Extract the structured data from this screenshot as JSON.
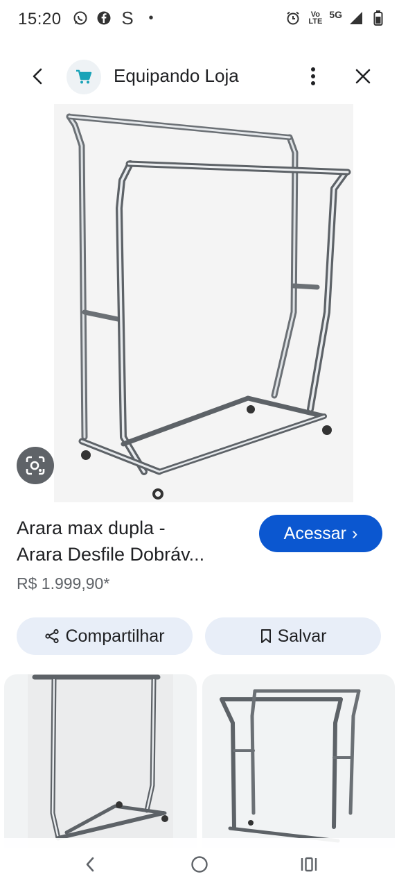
{
  "status_bar": {
    "time": "15:20",
    "left_icons": [
      "whatsapp-icon",
      "facebook-icon",
      "s-app-icon",
      "dot-icon"
    ],
    "s_glyph": "S",
    "dot_glyph": "•",
    "volte_line1": "Vo",
    "volte_line2": "LTE",
    "network": "5G",
    "right_icons": [
      "alarm-icon",
      "volte-icon",
      "signal-icon",
      "battery-icon"
    ]
  },
  "topbar": {
    "site_name": "Equipando Loja",
    "site_icon": "cart-icon"
  },
  "product": {
    "title_line1": "Arara max dupla -",
    "title_line2": "Arara Desfile Dobráv...",
    "price": "R$ 1.999,90*",
    "visit_label": "Acessar",
    "visit_chevron": "›"
  },
  "actions": {
    "share_label": "Compartilhar",
    "save_label": "Salvar"
  },
  "colors": {
    "accent": "#0b57d0",
    "pill_bg": "#e8eef8",
    "lens_bg": "#5f6368"
  },
  "navigation": {
    "icons": [
      "back-icon",
      "home-icon",
      "recent-apps-icon"
    ]
  }
}
